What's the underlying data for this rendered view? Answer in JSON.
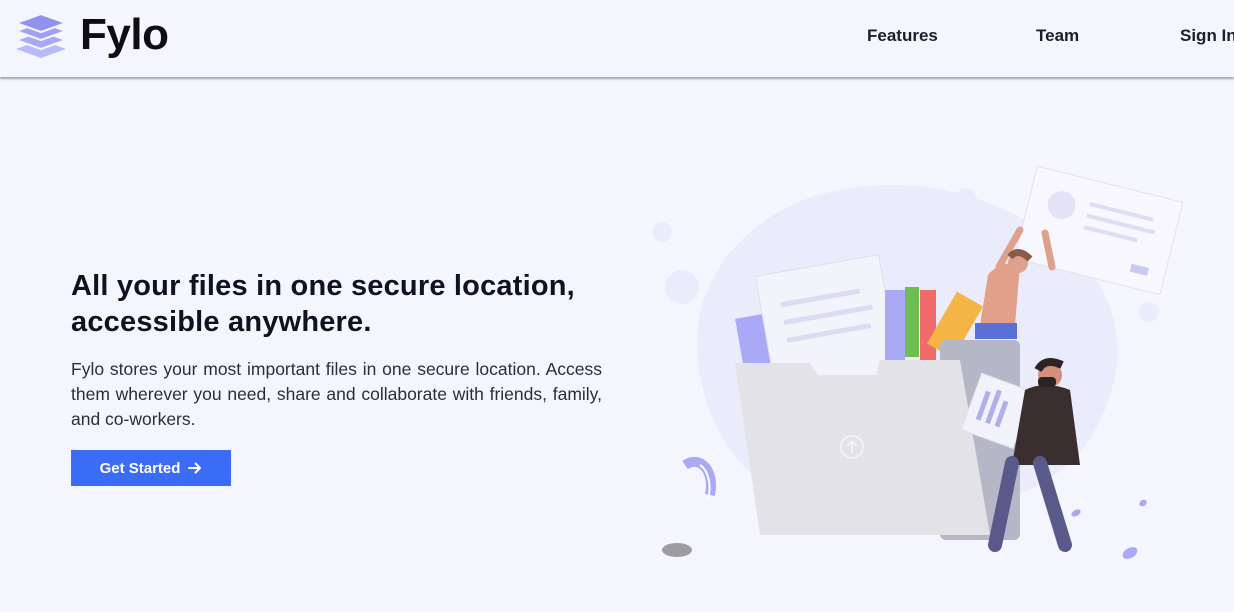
{
  "header": {
    "brand": "Fylo",
    "logo_icon": "stacked-layers-icon",
    "nav": [
      {
        "label": "Features"
      },
      {
        "label": "Team"
      },
      {
        "label": "Sign In"
      }
    ]
  },
  "hero": {
    "title": "All your files in one secure location, accessible anywhere.",
    "body": "Fylo stores your most important files in one secure location. Access them wherever you need, share and collaborate with friends, family, and co-workers.",
    "cta_label": "Get Started",
    "cta_icon": "arrow-right-icon",
    "illustration": "people-sharing-files-illustration"
  },
  "colors": {
    "accent": "#3a6cf6",
    "background": "#f5f6fd",
    "logo": "#a7a9f5"
  }
}
